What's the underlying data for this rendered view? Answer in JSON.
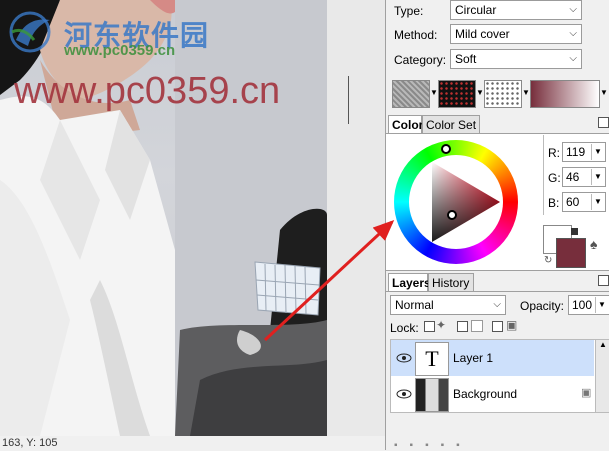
{
  "canvas": {
    "watermark_url": "www.pc0359.cn",
    "watermark_site": "河东软件园",
    "watermark_small": "www.pc0359.cn",
    "status_text": "163, Y: 105"
  },
  "gradient": {
    "type_label": "Type:",
    "type_value": "Circular",
    "method_label": "Method:",
    "method_value": "Mild cover",
    "category_label": "Category:",
    "category_value": "Soft"
  },
  "color_panel": {
    "tabs": [
      "Color",
      "Color Set"
    ],
    "r_label": "R:",
    "r_value": "119",
    "g_label": "G:",
    "g_value": "46",
    "b_label": "B:",
    "b_value": "60",
    "primary_color": "#772e3c",
    "secondary_color": "#ffffff"
  },
  "layers_panel": {
    "tabs": [
      "Layers",
      "History"
    ],
    "blend_mode": "Normal",
    "opacity_label": "Opacity:",
    "opacity_value": "100",
    "lock_label": "Lock:",
    "layers": [
      {
        "name": "Layer 1",
        "thumb": "T",
        "selected": true
      },
      {
        "name": "Background",
        "selected": false,
        "locked": true
      }
    ]
  },
  "colors": {
    "selection": "#cde0fb",
    "arrow": "#e0201f"
  }
}
